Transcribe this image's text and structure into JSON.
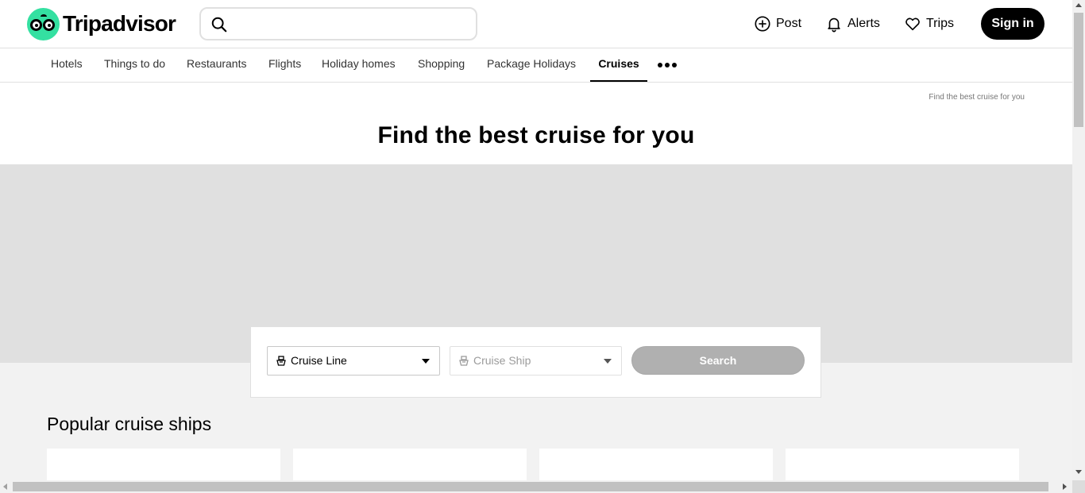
{
  "header": {
    "logo_text": "Tripadvisor",
    "search_placeholder": "",
    "post_label": "Post",
    "alerts_label": "Alerts",
    "trips_label": "Trips",
    "signin_label": "Sign in"
  },
  "nav": {
    "items": [
      {
        "label": "Hotels"
      },
      {
        "label": "Things to do"
      },
      {
        "label": "Restaurants"
      },
      {
        "label": "Flights"
      },
      {
        "label": "Holiday homes"
      },
      {
        "label": "Shopping"
      },
      {
        "label": "Package Holidays"
      },
      {
        "label": "Cruises"
      }
    ],
    "active": "Cruises"
  },
  "breadcrumb": "Find the best cruise for you",
  "page_title": "Find the best cruise for you",
  "cruise_search": {
    "line_label": "Cruise Line",
    "ship_label": "Cruise Ship",
    "search_label": "Search"
  },
  "popular": {
    "title": "Popular cruise ships"
  },
  "colors": {
    "brand": "#34e0a1",
    "hero_bg": "#e0e0e0",
    "page_bg": "#f2f2f2",
    "button_disabled": "#b0b0b0"
  }
}
